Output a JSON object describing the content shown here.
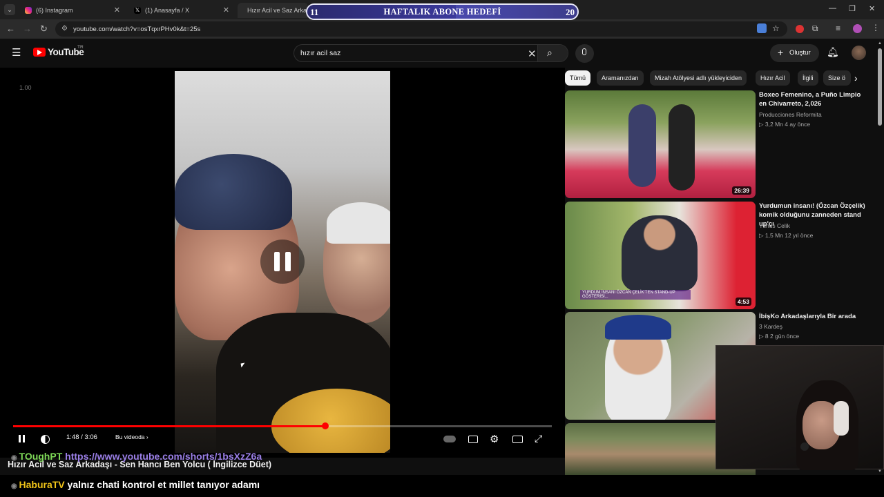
{
  "browser": {
    "tabs": [
      {
        "label": "(6) Instagram",
        "color": "#d6249f"
      },
      {
        "label": "(1) Anasayfa / X",
        "color": "#ffffff"
      },
      {
        "label": "Hızır Acil ve Saz Arkad",
        "color": "#ff0000"
      }
    ],
    "url": "youtube.com/watch?v=osTqxrPHv0k&t=25s"
  },
  "overlay_banner": {
    "left_num": "11",
    "title": "HAFTALIK ABONE HEDEFİ",
    "right_num": "20",
    "progress": 0.55
  },
  "youtube": {
    "logo_text": "YouTube",
    "region": "TR",
    "search_query": "hızır acil saz",
    "create_label": "Oluştur"
  },
  "chips": [
    "Tümü",
    "Aramanızdan",
    "Mizah Atölyesi adlı yükleyiciden",
    "Hızır Acil",
    "İlgili",
    "Size ö"
  ],
  "player": {
    "rate": "1.00",
    "time": "1:48 / 3:06",
    "in_video": "Bu videoda",
    "progress": 0.58
  },
  "video_title": "Hızır Acil ve Saz Arkadaşı - Sen Hancı Ben Yolcu ( İngilizce Düet)",
  "chat": [
    {
      "user": "TOughPT",
      "message": "https://www.youtube.com/shorts/1bsXzZ6a",
      "user_color": "#7ed957",
      "message_color": "#9b7fe8"
    },
    {
      "user": "HaburaTV",
      "message": "yalnız chati kontrol et millet tanıyor adamı",
      "user_color": "#f0c419",
      "message_color": "#ffffff"
    }
  ],
  "recommendations": [
    {
      "title": "Boxeo Femenino, a Puño Limpio en Chivarreto,  2,026",
      "channel": "Producciones Reformita",
      "meta": "▷ 3,2 Mn   4 ay önce",
      "duration": "26:39"
    },
    {
      "title": "Yurdumun insanı! (Özcan Özçelik) komik olduğunu zanneden stand up'çı",
      "channel": "Yunus Celik",
      "meta": "▷ 1,5 Mn   12 yıl önce",
      "duration": "4:53",
      "caption": "YURDUM İNSANI ÖZCAN ÇELİK'TEN STAND-UP GÖSTERİSİ..."
    },
    {
      "title": "İbişKo Arkadaşlarıyla Bir arada",
      "channel": "3 Kardeş",
      "meta": "▷ 8   2 gün önce"
    }
  ]
}
